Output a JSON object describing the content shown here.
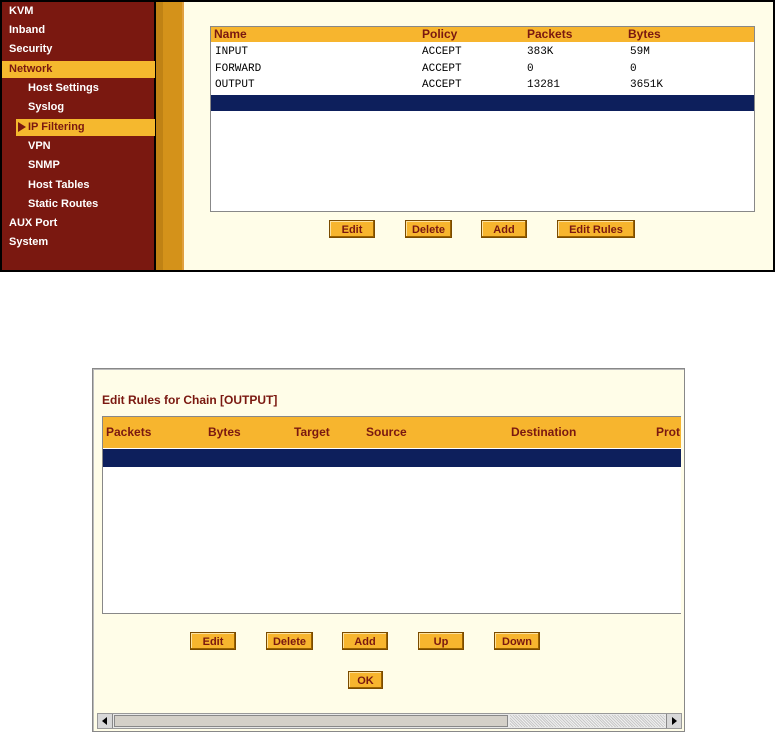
{
  "sidebar": {
    "items": [
      {
        "label": "KVM"
      },
      {
        "label": "Inband"
      },
      {
        "label": "Security"
      },
      {
        "label": "Network"
      },
      {
        "label": "Host Settings"
      },
      {
        "label": "Syslog"
      },
      {
        "label": "IP Filtering"
      },
      {
        "label": "VPN"
      },
      {
        "label": "SNMP"
      },
      {
        "label": "Host Tables"
      },
      {
        "label": "Static Routes"
      },
      {
        "label": "AUX Port"
      },
      {
        "label": "System"
      }
    ]
  },
  "chains_table": {
    "headers": [
      "Name",
      "Policy",
      "Packets",
      "Bytes"
    ],
    "rows": [
      [
        "INPUT",
        "ACCEPT",
        "383K",
        "59M"
      ],
      [
        "FORWARD",
        "ACCEPT",
        "0",
        "0"
      ],
      [
        "OUTPUT",
        "ACCEPT",
        "13281",
        "3651K"
      ]
    ]
  },
  "chains_buttons": {
    "edit": "Edit",
    "delete": "Delete",
    "add": "Add",
    "edit_rules": "Edit Rules"
  },
  "rules_dialog": {
    "title": "Edit Rules for Chain [OUTPUT]",
    "headers": [
      "Packets",
      "Bytes",
      "Target",
      "Source",
      "Destination",
      "Prot"
    ],
    "buttons": {
      "edit": "Edit",
      "delete": "Delete",
      "add": "Add",
      "up": "Up",
      "down": "Down",
      "ok": "OK"
    }
  },
  "colors": {
    "sidebar_bg": "#7a1810",
    "accent": "#f7b52e",
    "selected_row": "#0d1f5c",
    "panel_bg": "#fffde8"
  }
}
